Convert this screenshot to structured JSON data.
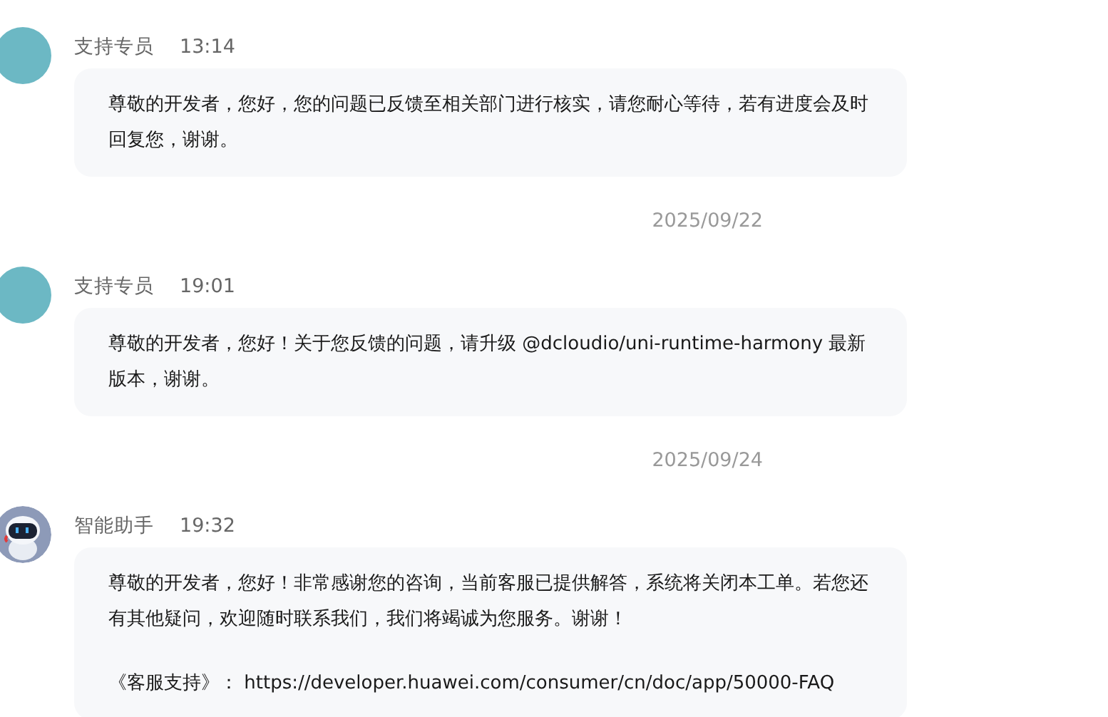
{
  "messages": [
    {
      "avatar": {
        "kind": "agent"
      },
      "sender": "支持专员",
      "time": "13:14",
      "paragraphs": [
        "尊敬的开发者，您好，您的问题已反馈至相关部门进行核实，请您耐心等待，若有进度会及时回复您，谢谢。"
      ]
    },
    {
      "date": "2025/09/22"
    },
    {
      "avatar": {
        "kind": "agent"
      },
      "sender": "支持专员",
      "time": "19:01",
      "paragraphs": [
        "尊敬的开发者，您好！关于您反馈的问题，请升级 @dcloudio/uni-runtime-harmony 最新版本，谢谢。"
      ]
    },
    {
      "date": "2025/09/24"
    },
    {
      "avatar": {
        "kind": "bot"
      },
      "sender": "智能助手",
      "time": "19:32",
      "paragraphs": [
        "尊敬的开发者，您好！非常感谢您的咨询，当前客服已提供解答，系统将关闭本工单。若您还有其他疑问，欢迎随时联系我们，我们将竭诚为您服务。谢谢！",
        "《客服支持》： https://developer.huawei.com/consumer/cn/doc/app/50000-FAQ"
      ]
    }
  ]
}
